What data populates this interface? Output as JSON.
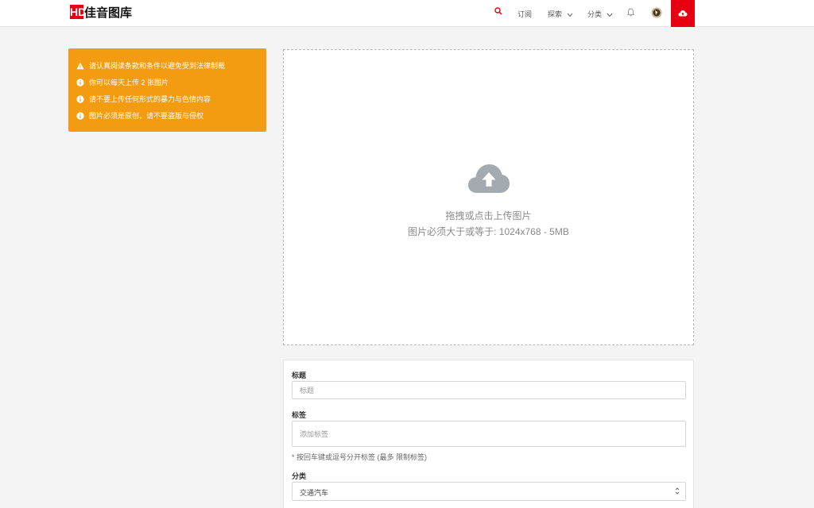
{
  "header": {
    "logo_mark": "HD",
    "logo_text": "佳音图库",
    "nav": {
      "subscribe": "订阅",
      "explore": "探索",
      "categories": "分类"
    },
    "icons": [
      "search-icon",
      "bell-icon",
      "avatar",
      "cloud-upload-icon"
    ],
    "accent_color": "#e60012"
  },
  "notice": {
    "color": "#f39c12",
    "items": [
      {
        "icon": "warning-icon",
        "text": "请认真阅读条款和条件以避免受到法律制裁"
      },
      {
        "icon": "info-icon",
        "text": "你可以每天上传 2 张图片"
      },
      {
        "icon": "info-icon",
        "text": "请不要上传任何形式的暴力与色情内容"
      },
      {
        "icon": "info-icon",
        "text": "图片必须是原创，请不要盗版与侵权"
      }
    ]
  },
  "dropzone": {
    "icon": "cloud-upload-icon",
    "line1": "拖拽或点击上传图片",
    "line2": "图片必须大于或等于: 1024x768 - 5MB"
  },
  "form": {
    "title_label": "标题",
    "title_placeholder": "标题",
    "tags_label": "标签",
    "tags_placeholder": "添加标签",
    "tags_hint": "* 按回车键或逗号分开标签 (最多 限制标签)",
    "category_label": "分类",
    "category_value": "交通汽车"
  }
}
